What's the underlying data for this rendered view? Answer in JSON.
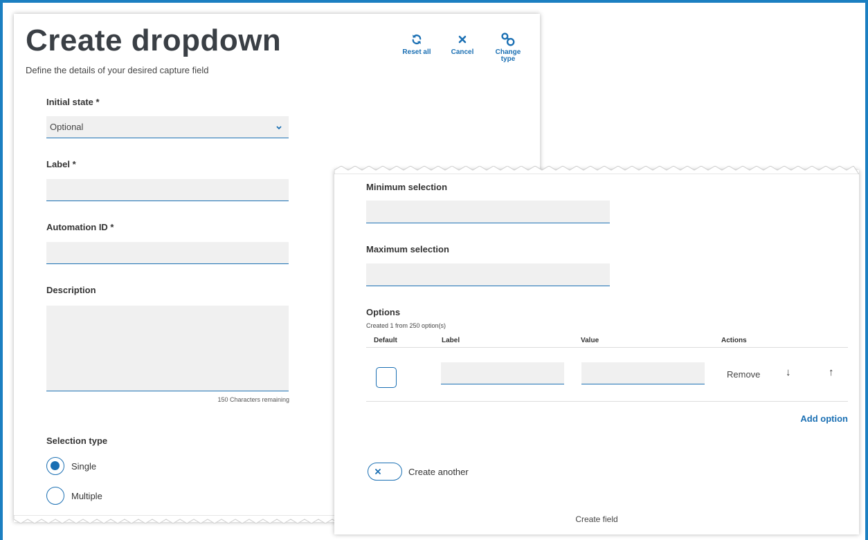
{
  "create_form": {
    "title": "Create dropdown",
    "subtitle": "Define the details of your desired capture field",
    "toolbar": {
      "reset_label": "Reset all",
      "cancel_label": "Cancel",
      "change_type_line1": "Change",
      "change_type_line2": "type"
    },
    "initial_state": {
      "label": "Initial state *",
      "value": "Optional"
    },
    "label_field": {
      "label": "Label *",
      "value": ""
    },
    "automation_id": {
      "label": "Automation ID *",
      "value": ""
    },
    "description": {
      "label": "Description",
      "value": "",
      "remaining": "150 Characters remaining"
    },
    "selection_type": {
      "label": "Selection type",
      "options": [
        {
          "label": "Single",
          "selected": true
        },
        {
          "label": "Multiple",
          "selected": false
        }
      ]
    }
  },
  "options_form": {
    "min_selection": {
      "label": "Minimum selection",
      "value": ""
    },
    "max_selection": {
      "label": "Maximum selection",
      "value": ""
    },
    "options": {
      "label": "Options",
      "created_text": "Created 1 from 250 option(s)",
      "columns": [
        "Default",
        "Label",
        "Value",
        "Actions"
      ],
      "rows": [
        {
          "default": false,
          "label": "",
          "value": "",
          "remove_label": "Remove",
          "down": "↓",
          "up": "↑"
        }
      ],
      "add_label": "Add option"
    },
    "create_another": {
      "label": "Create another",
      "enabled": false
    },
    "create_button": "Create field"
  },
  "colors": {
    "accent": "#1a6fb3",
    "frame": "#1b7fc1",
    "input_bg": "#f0f0f0",
    "title": "#3a3f45"
  }
}
